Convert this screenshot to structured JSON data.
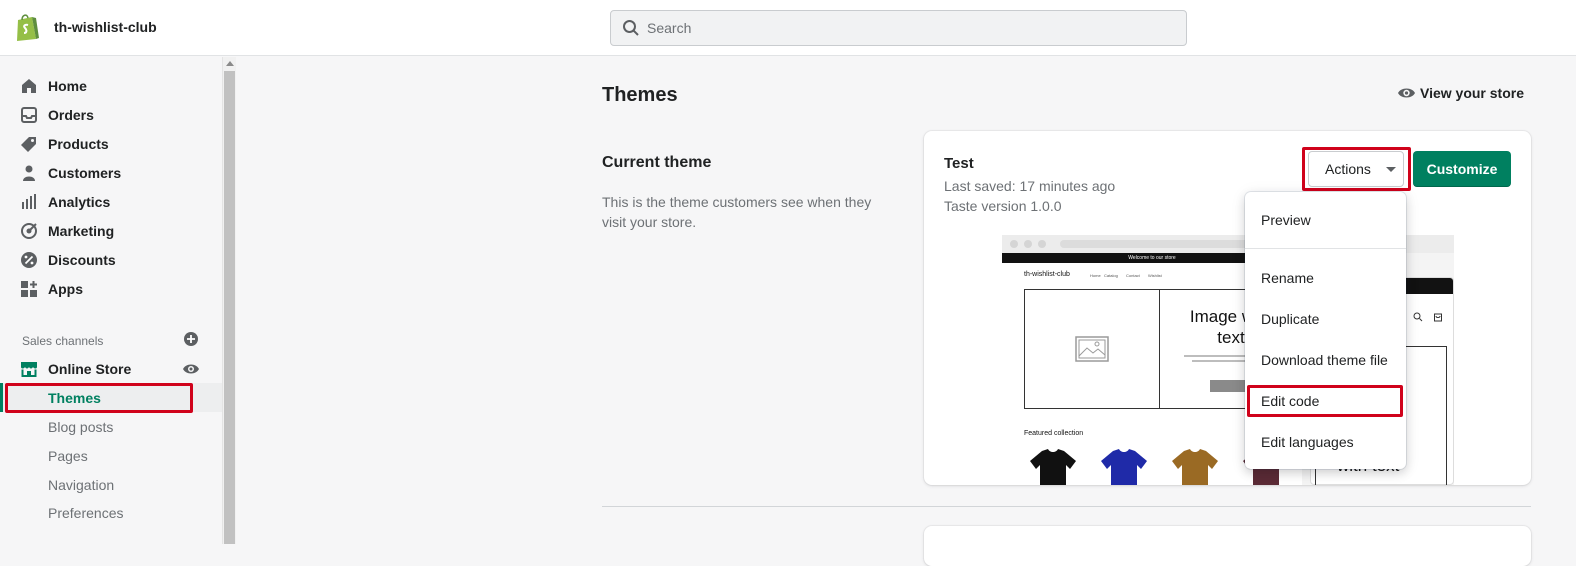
{
  "app": {
    "store_name": "th-wishlist-club",
    "logo": "shopify-bag-logo"
  },
  "search": {
    "placeholder": "Search",
    "icon": "search-icon"
  },
  "sidebar": {
    "items": [
      {
        "label": "Home",
        "icon": "home-icon"
      },
      {
        "label": "Orders",
        "icon": "orders-icon"
      },
      {
        "label": "Products",
        "icon": "tag-icon"
      },
      {
        "label": "Customers",
        "icon": "person-icon"
      },
      {
        "label": "Analytics",
        "icon": "bar-chart-icon"
      },
      {
        "label": "Marketing",
        "icon": "target-icon"
      },
      {
        "label": "Discounts",
        "icon": "discount-icon"
      },
      {
        "label": "Apps",
        "icon": "apps-icon"
      }
    ],
    "sales_channels_label": "Sales channels",
    "online_store": {
      "label": "Online Store",
      "icon": "store-icon"
    },
    "sub_items": [
      {
        "label": "Themes",
        "active": true
      },
      {
        "label": "Blog posts"
      },
      {
        "label": "Pages"
      },
      {
        "label": "Navigation"
      },
      {
        "label": "Preferences"
      }
    ]
  },
  "main": {
    "title": "Themes",
    "view_store_label": "View your store",
    "current_theme": {
      "heading": "Current theme",
      "description": "This is the theme customers see when they visit your store."
    },
    "theme_card": {
      "name": "Test",
      "last_saved": "Last saved: 17 minutes ago",
      "version": "Taste version 1.0.0",
      "actions_label": "Actions",
      "customize_label": "Customize"
    },
    "preview": {
      "announcement": "Welcome to our store",
      "store_name": "th-wishlist-club",
      "nav": [
        "Home",
        "Catalog",
        "Contact",
        "Wishlist"
      ],
      "hero_title": "Image with text",
      "featured_label": "Featured collection",
      "mobile_text": "with text",
      "tshirt_colors": [
        "#111111",
        "#1f2aa8",
        "#9a6a24",
        "#5b2b36"
      ]
    },
    "actions_menu": {
      "items": [
        "Preview",
        "Rename",
        "Duplicate",
        "Download theme file",
        "Edit code",
        "Edit languages"
      ],
      "highlighted": "Edit code"
    }
  },
  "colors": {
    "brand_green": "#008060",
    "highlight_red": "#d0021b"
  }
}
